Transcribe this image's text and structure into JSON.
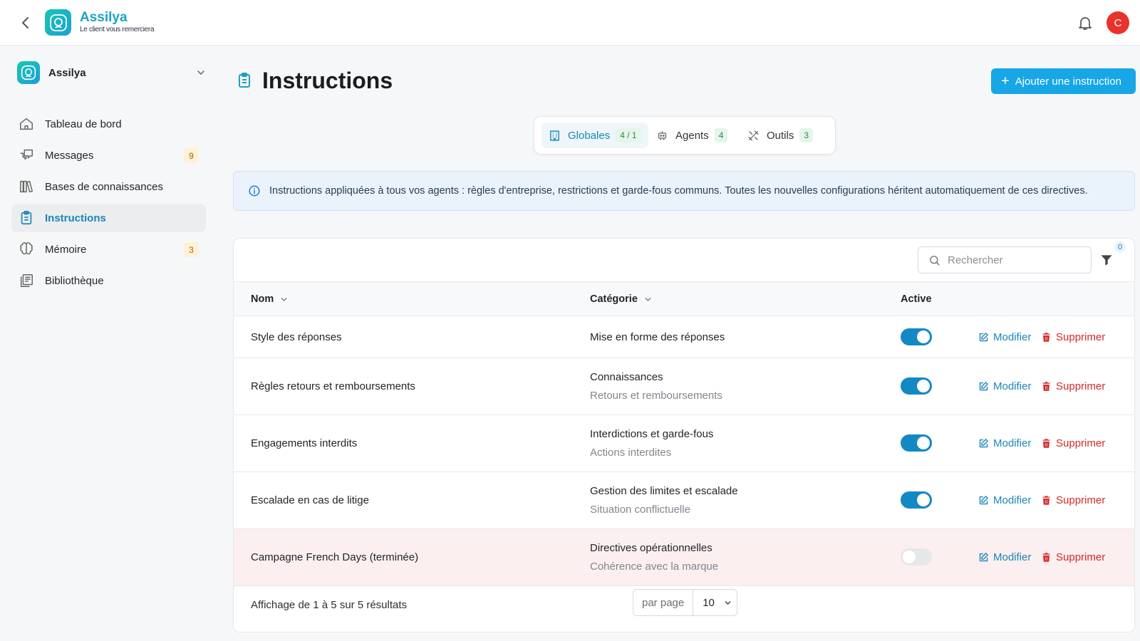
{
  "app": {
    "brand_name": "Assilya",
    "brand_tagline": "Le client vous remerciera",
    "avatar_initial": "C",
    "accent_color": "#17a6e6"
  },
  "sidebar": {
    "workspace_name": "Assilya",
    "items": [
      {
        "label": "Tableau de bord",
        "icon": "home-icon",
        "badge": ""
      },
      {
        "label": "Messages",
        "icon": "chat-icon",
        "badge": "9"
      },
      {
        "label": "Bases de connaissances",
        "icon": "books-icon",
        "badge": ""
      },
      {
        "label": "Instructions",
        "icon": "clipboard-icon",
        "badge": "",
        "active": true
      },
      {
        "label": "Mémoire",
        "icon": "brain-icon",
        "badge": "3"
      },
      {
        "label": "Bibliothèque",
        "icon": "library-icon",
        "badge": ""
      }
    ]
  },
  "main": {
    "title": "Instructions",
    "add_button_label": "Ajouter une instruction",
    "tabs": [
      {
        "label": "Globales",
        "count": "4 / 1",
        "icon": "building-icon",
        "active": true
      },
      {
        "label": "Agents",
        "count": "4",
        "icon": "robot-icon"
      },
      {
        "label": "Outils",
        "count": "3",
        "icon": "tools-icon"
      }
    ],
    "info_text": "Instructions appliquées à tous vos agents : règles d'entreprise, restrictions et garde-fous communs. Toutes les nouvelles configurations héritent automatiquement de ces directives."
  },
  "table": {
    "search_placeholder": "Rechercher",
    "filter_count": "0",
    "columns": {
      "name": "Nom",
      "category": "Catégorie",
      "active": "Active"
    },
    "edit_label": "Modifier",
    "delete_label": "Supprimer",
    "rows": [
      {
        "name": "Style des réponses",
        "category": "Mise en forme des réponses",
        "subcategory": "",
        "active": true
      },
      {
        "name": "Règles retours et remboursements",
        "category": "Connaissances",
        "subcategory": "Retours et remboursements",
        "active": true
      },
      {
        "name": "Engagements interdits",
        "category": "Interdictions et garde-fous",
        "subcategory": "Actions interdites",
        "active": true
      },
      {
        "name": "Escalade en cas de litige",
        "category": "Gestion des limites et escalade",
        "subcategory": "Situation conflictuelle",
        "active": true
      },
      {
        "name": "Campagne French Days (terminée)",
        "category": "Directives opérationnelles",
        "subcategory": "Cohérence avec la marque",
        "active": false
      }
    ],
    "footer_text": "Affichage de 1 à 5 sur 5 résultats",
    "per_page_label": "par page",
    "per_page_value": "10"
  }
}
